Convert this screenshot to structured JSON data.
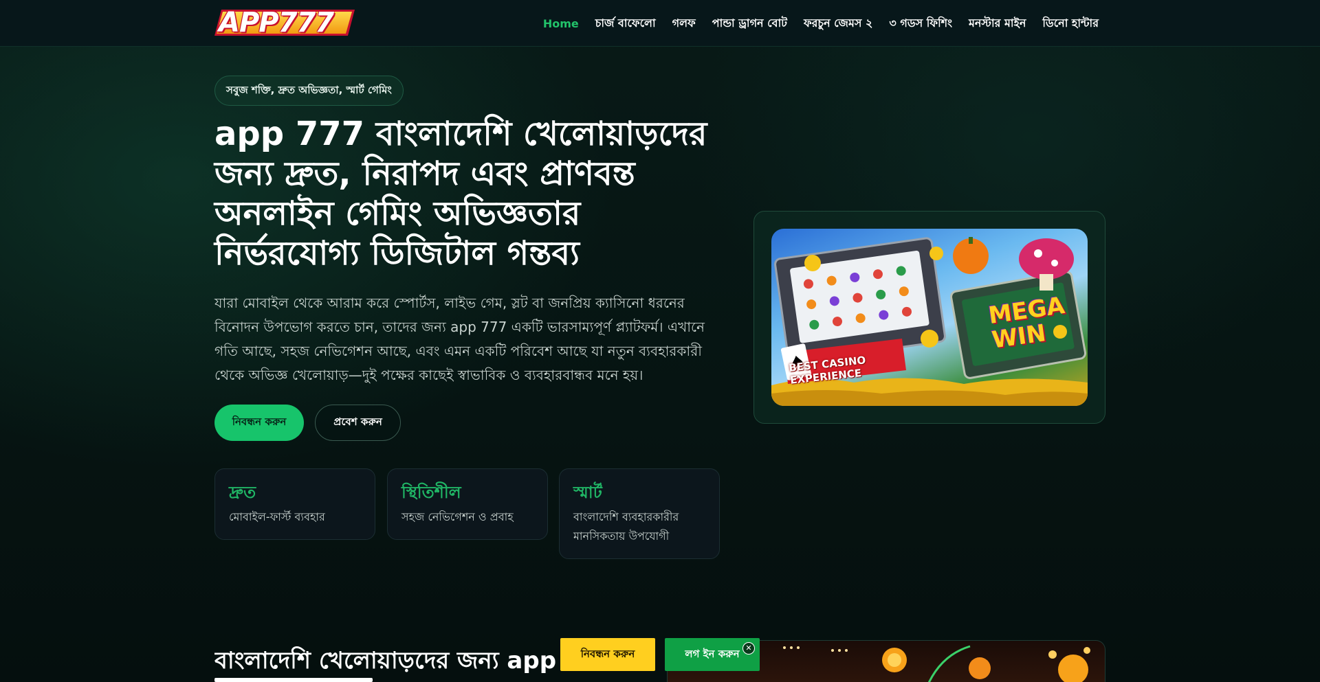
{
  "header": {
    "logo_text": "APP777",
    "nav": [
      {
        "label": "Home"
      },
      {
        "label": "চার্জ বাফেলো"
      },
      {
        "label": "গলফ"
      },
      {
        "label": "পান্ডা ড্রাগন বোট"
      },
      {
        "label": "ফরচুন জেমস ২"
      },
      {
        "label": "৩ গডস ফিশিং"
      },
      {
        "label": "মনস্টার মাইন"
      },
      {
        "label": "ডিনো হান্টার"
      }
    ]
  },
  "hero": {
    "pill": "সবুজ শক্তি, দ্রুত অভিজ্ঞতা, স্মার্ট গেমিং",
    "title": "app 777 বাংলাদেশি খেলোয়াড়দের জন্য দ্রুত, নিরাপদ এবং প্রাণবন্ত অনলাইন গেমিং অভিজ্ঞতার নির্ভরযোগ্য ডিজিটাল গন্তব্য",
    "description": "যারা মোবাইল থেকে আরাম করে স্পোর্টস, লাইভ গেম, স্লট বা জনপ্রিয় ক্যাসিনো ধরনের বিনোদন উপভোগ করতে চান, তাদের জন্য app 777 একটি ভারসাম্যপূর্ণ প্ল্যাটফর্ম। এখানে গতি আছে, সহজ নেভিগেশন আছে, এবং এমন একটি পরিবেশ আছে যা নতুন ব্যবহারকারী থেকে অভিজ্ঞ খেলোয়াড়—দুই পক্ষের কাছেই স্বাভাবিক ও ব্যবহারবান্ধব মনে হয়।",
    "register_label": "নিবন্ধন করুন",
    "login_label": "প্রবেশ করুন",
    "features": [
      {
        "title": "দ্রুত",
        "text": "মোবাইল-ফার্স্ট ব্যবহার"
      },
      {
        "title": "স্থিতিশীল",
        "text": "সহজ নেভিগেশন ও প্রবাহ"
      },
      {
        "title": "স্মার্ট",
        "text": "বাংলাদেশি ব্যবহারকারীর মানসিকতায় উপযোগী"
      }
    ],
    "image": {
      "caption": "BEST CASINO EXPERIENCE",
      "badge": "MEGA WIN"
    }
  },
  "section2": {
    "title": "বাংলাদেশি খেলোয়াড়দের জন্য app 777"
  },
  "sticky_bar": {
    "register_label": "নিবন্ধন করুন",
    "login_label": "লগ ইন করুন",
    "close_icon": "close-icon"
  },
  "colors": {
    "accent_green": "#17c46b",
    "nav_active": "#22c36a",
    "sticky_yellow": "#ffcf1f",
    "sticky_green": "#0fa045"
  }
}
